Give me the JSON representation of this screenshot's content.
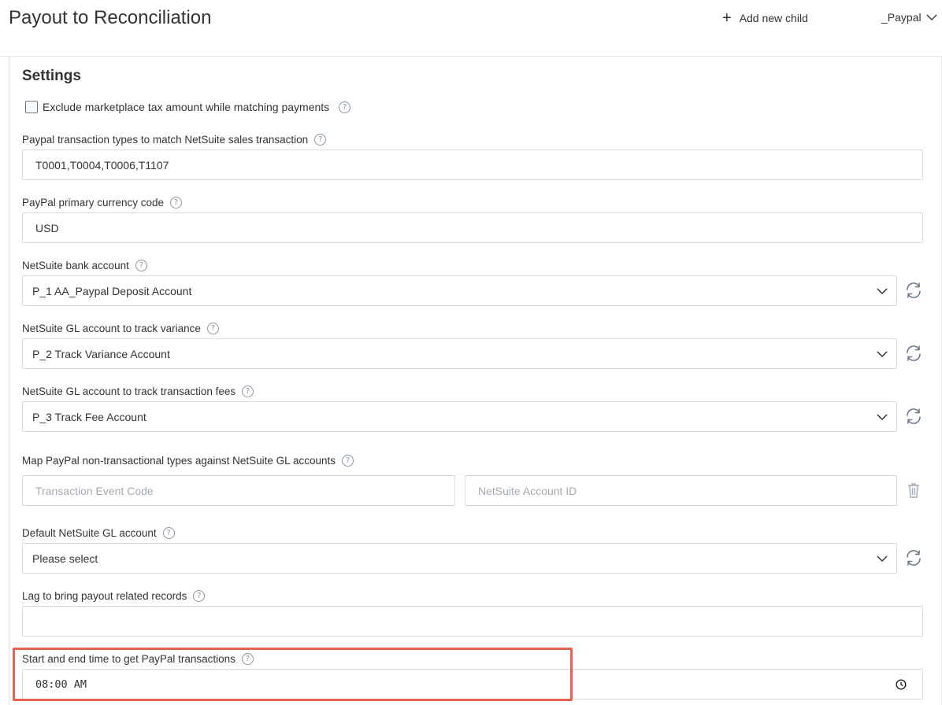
{
  "header": {
    "title": "Payout to Reconciliation",
    "add_child_label": "Add new child",
    "store_label": "_Paypal"
  },
  "settings": {
    "title": "Settings",
    "exclude_tax_label": "Exclude marketplace tax amount while matching payments",
    "txn_types": {
      "label": "Paypal transaction types to match NetSuite sales transaction",
      "value": "T0001,T0004,T0006,T1107"
    },
    "currency": {
      "label": "PayPal primary currency code",
      "value": "USD"
    },
    "bank_account": {
      "label": "NetSuite bank account",
      "value": "P_1 AA_Paypal Deposit Account"
    },
    "variance_account": {
      "label": "NetSuite GL account to track variance",
      "value": "P_2 Track Variance Account"
    },
    "fee_account": {
      "label": "NetSuite GL account to track transaction fees",
      "value": "P_3 Track Fee Account"
    },
    "map_types": {
      "label": "Map PayPal non-transactional types against NetSuite GL accounts",
      "event_code_placeholder": "Transaction Event Code",
      "account_id_placeholder": "NetSuite Account ID"
    },
    "default_account": {
      "label": "Default NetSuite GL account",
      "value": "Please select"
    },
    "lag": {
      "label": "Lag to bring payout related records",
      "value": ""
    },
    "time_range": {
      "label": "Start and end time to get PayPal transactions",
      "value": "08:00 AM"
    }
  },
  "colors": {
    "highlight": "#e8604f",
    "border": "#d6dbe0",
    "help": "#8a96a3"
  }
}
